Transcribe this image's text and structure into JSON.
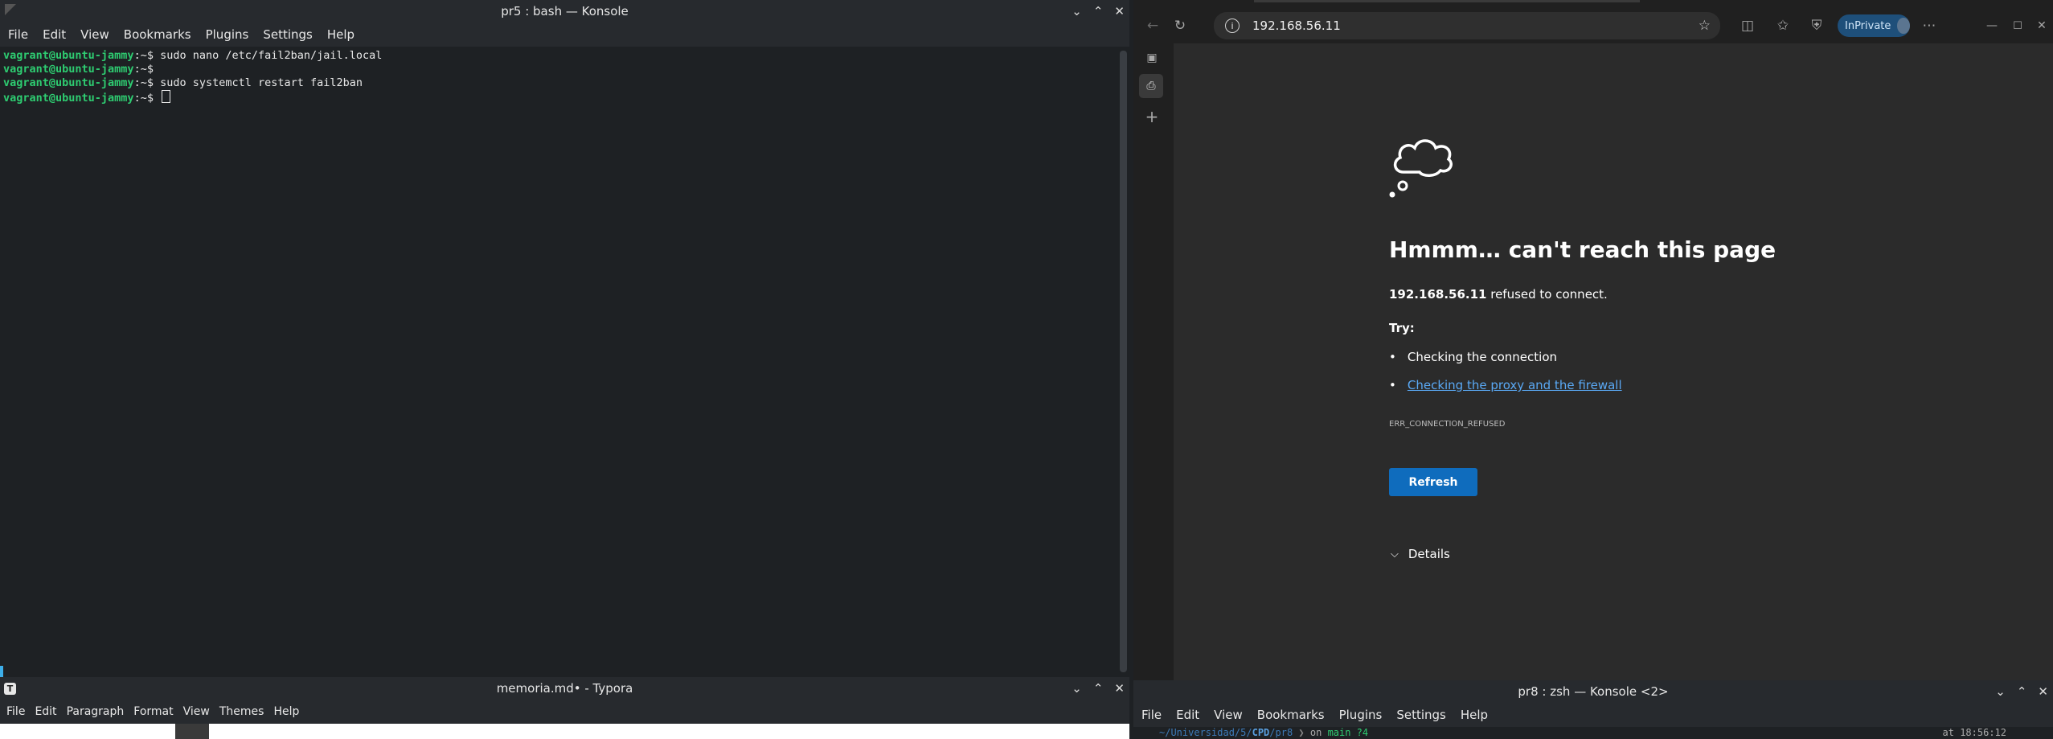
{
  "konsole_top": {
    "title": "pr5 : bash — Konsole",
    "menu": [
      "File",
      "Edit",
      "View",
      "Bookmarks",
      "Plugins",
      "Settings",
      "Help"
    ],
    "lines": [
      {
        "prompt": "vagrant@ubuntu-jammy",
        "sep": ":~$",
        "cmd": " sudo nano /etc/fail2ban/jail.local"
      },
      {
        "prompt": "vagrant@ubuntu-jammy",
        "sep": ":~$",
        "cmd": ""
      },
      {
        "prompt": "vagrant@ubuntu-jammy",
        "sep": ":~$",
        "cmd": " sudo systemctl restart fail2ban"
      },
      {
        "prompt": "vagrant@ubuntu-jammy",
        "sep": ":~$",
        "cmd": " "
      }
    ]
  },
  "typora": {
    "title": "memoria.md• - Typora",
    "menu": [
      "File",
      "Edit",
      "Paragraph",
      "Format",
      "View",
      "Themes",
      "Help"
    ]
  },
  "browser": {
    "address": "192.168.56.11",
    "inprivate_label": "InPrivate",
    "error_heading": "Hmmm… can't reach this page",
    "host": "192.168.56.11",
    "refused_text": " refused to connect.",
    "try_label": "Try:",
    "suggestion_1": "Checking the connection",
    "suggestion_2": "Checking the proxy and the firewall",
    "error_code": "ERR_CONNECTION_REFUSED",
    "refresh_label": "Refresh",
    "details_label": "Details"
  },
  "konsole_bottom": {
    "title": "pr8 : zsh — Konsole <2>",
    "menu": [
      "File",
      "Edit",
      "View",
      "Bookmarks",
      "Plugins",
      "Settings",
      "Help"
    ],
    "path_prefix": "~/Universidad/5/",
    "path_bold": "CPD",
    "path_suffix": "/pr8",
    "git_on": "on",
    "git_branch": "main ?4",
    "time": "at 18:56:12"
  },
  "colors": {
    "accent": "#0f6cbd",
    "prompt_green": "#2ecc71",
    "link": "#5aa9f5"
  }
}
